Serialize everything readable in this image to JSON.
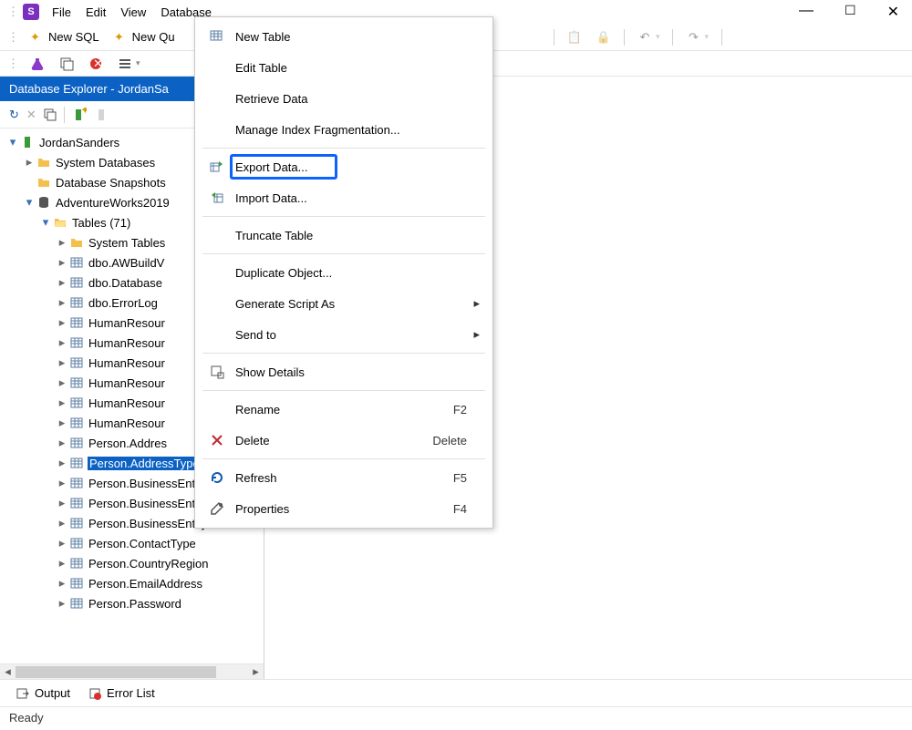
{
  "titlebar": {
    "logo_letter": "S"
  },
  "menubar": {
    "items": [
      "File",
      "Edit",
      "View",
      "Database"
    ]
  },
  "toolbar": {
    "new_sql": "New SQL",
    "new_query": "New Qu"
  },
  "panel": {
    "title": "Database Explorer - JordanSa"
  },
  "tree": {
    "server": "JordanSanders",
    "sys_db": "System Databases",
    "snapshots": "Database Snapshots",
    "db": "AdventureWorks2019",
    "tables": "Tables (71)",
    "system_tables": "System Tables",
    "rows": [
      "dbo.AWBuildV",
      "dbo.Database",
      "dbo.ErrorLog",
      "HumanResour",
      "HumanResour",
      "HumanResour",
      "HumanResour",
      "HumanResour",
      "HumanResour",
      "Person.Addres",
      "Person.AddressType",
      "Person.BusinessEntity",
      "Person.BusinessEntityAd",
      "Person.BusinessEntityCo",
      "Person.ContactType",
      "Person.CountryRegion",
      "Person.EmailAddress",
      "Person.Password"
    ],
    "selected_index": 10
  },
  "context_menu": {
    "items": [
      {
        "label": "New Table",
        "icon": "table"
      },
      {
        "label": "Edit Table"
      },
      {
        "label": "Retrieve Data"
      },
      {
        "label": "Manage Index Fragmentation..."
      },
      {
        "sep": true
      },
      {
        "label": "Export Data...",
        "icon": "export",
        "highlight": true
      },
      {
        "label": "Import Data...",
        "icon": "import"
      },
      {
        "sep": true
      },
      {
        "label": "Truncate Table"
      },
      {
        "sep": true
      },
      {
        "label": "Duplicate Object..."
      },
      {
        "label": "Generate Script As",
        "submenu": true
      },
      {
        "label": "Send to",
        "submenu": true
      },
      {
        "sep": true
      },
      {
        "label": "Show Details",
        "icon": "details"
      },
      {
        "sep": true
      },
      {
        "label": "Rename",
        "shortcut": "F2"
      },
      {
        "label": "Delete",
        "shortcut": "Delete",
        "icon": "delete"
      },
      {
        "sep": true
      },
      {
        "label": "Refresh",
        "shortcut": "F5",
        "icon": "refresh"
      },
      {
        "label": "Properties",
        "shortcut": "F4",
        "icon": "props"
      }
    ]
  },
  "bottom_tabs": {
    "output": "Output",
    "error_list": "Error List"
  },
  "statusbar": {
    "text": "Ready"
  }
}
